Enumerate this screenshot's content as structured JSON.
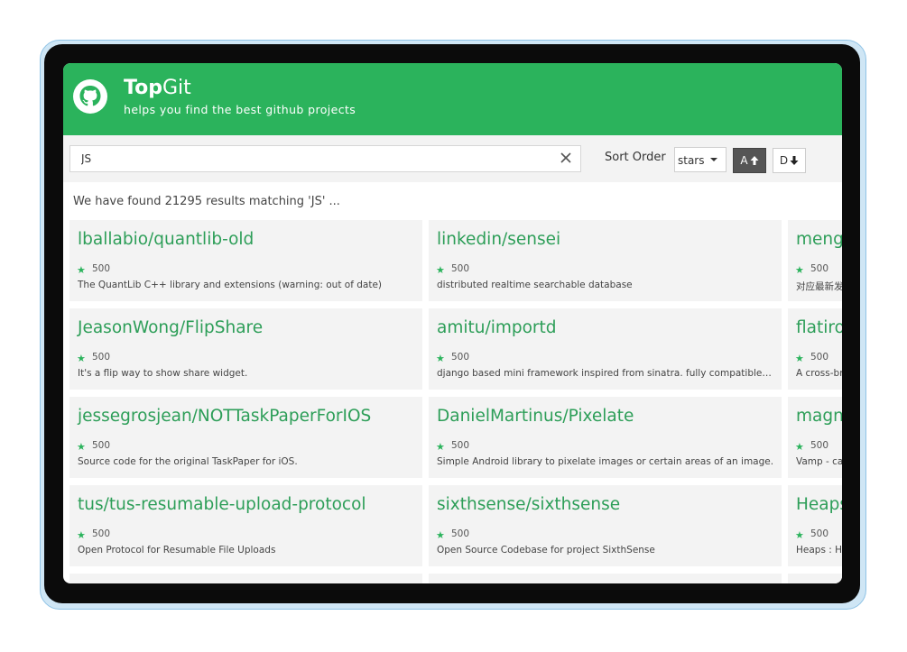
{
  "header": {
    "title_bold": "Top",
    "title_rest": "Git",
    "subtitle": "helps you find the best github projects",
    "accent_color": "#2bb35c",
    "logo_icon": "github-octocat-icon"
  },
  "toolbar": {
    "search_value": "JS",
    "clear_icon": "close-icon",
    "sort_label": "Sort Order",
    "sort_selected": "stars",
    "asc_label": "A",
    "desc_label": "D"
  },
  "results": {
    "summary": "We have found 21295 results matching 'JS' ..."
  },
  "columns": [
    {
      "cards": [
        {
          "name": "lballabio/quantlib-old",
          "stars": "500",
          "description": "The QuantLib C++ library and extensions (warning: out of date)"
        },
        {
          "name": "JeasonWong/FlipShare",
          "stars": "500",
          "description": "It's a flip way to show share widget."
        },
        {
          "name": "jessegrosjean/NOTTaskPaperForIOS",
          "stars": "500",
          "description": "Source code for the original TaskPaper for iOS."
        },
        {
          "name": "tus/tus-resumable-upload-protocol",
          "stars": "500",
          "description": "Open Protocol for Resumable File Uploads"
        }
      ]
    },
    {
      "cards": [
        {
          "name": "linkedin/sensei",
          "stars": "500",
          "description": "distributed realtime searchable database"
        },
        {
          "name": "amitu/importd",
          "stars": "500",
          "description": "django based mini framework inspired from sinatra. fully compatible with dja..."
        },
        {
          "name": "DanielMartinus/Pixelate",
          "stars": "500",
          "description": "Simple Android library to pixelate images or certain areas of an image."
        },
        {
          "name": "sixthsense/sixthsense",
          "stars": "500",
          "description": "Open Source Codebase for project SixthSense"
        }
      ]
    },
    {
      "cards": [
        {
          "name": "mengx",
          "stars": "500",
          "description": "对应最新发"
        },
        {
          "name": "flatiron",
          "stars": "500",
          "description": "A cross-bro"
        },
        {
          "name": "magne",
          "stars": "500",
          "description": "Vamp - can"
        },
        {
          "name": "Heaps",
          "stars": "500",
          "description": "Heaps : Ha"
        }
      ]
    }
  ]
}
